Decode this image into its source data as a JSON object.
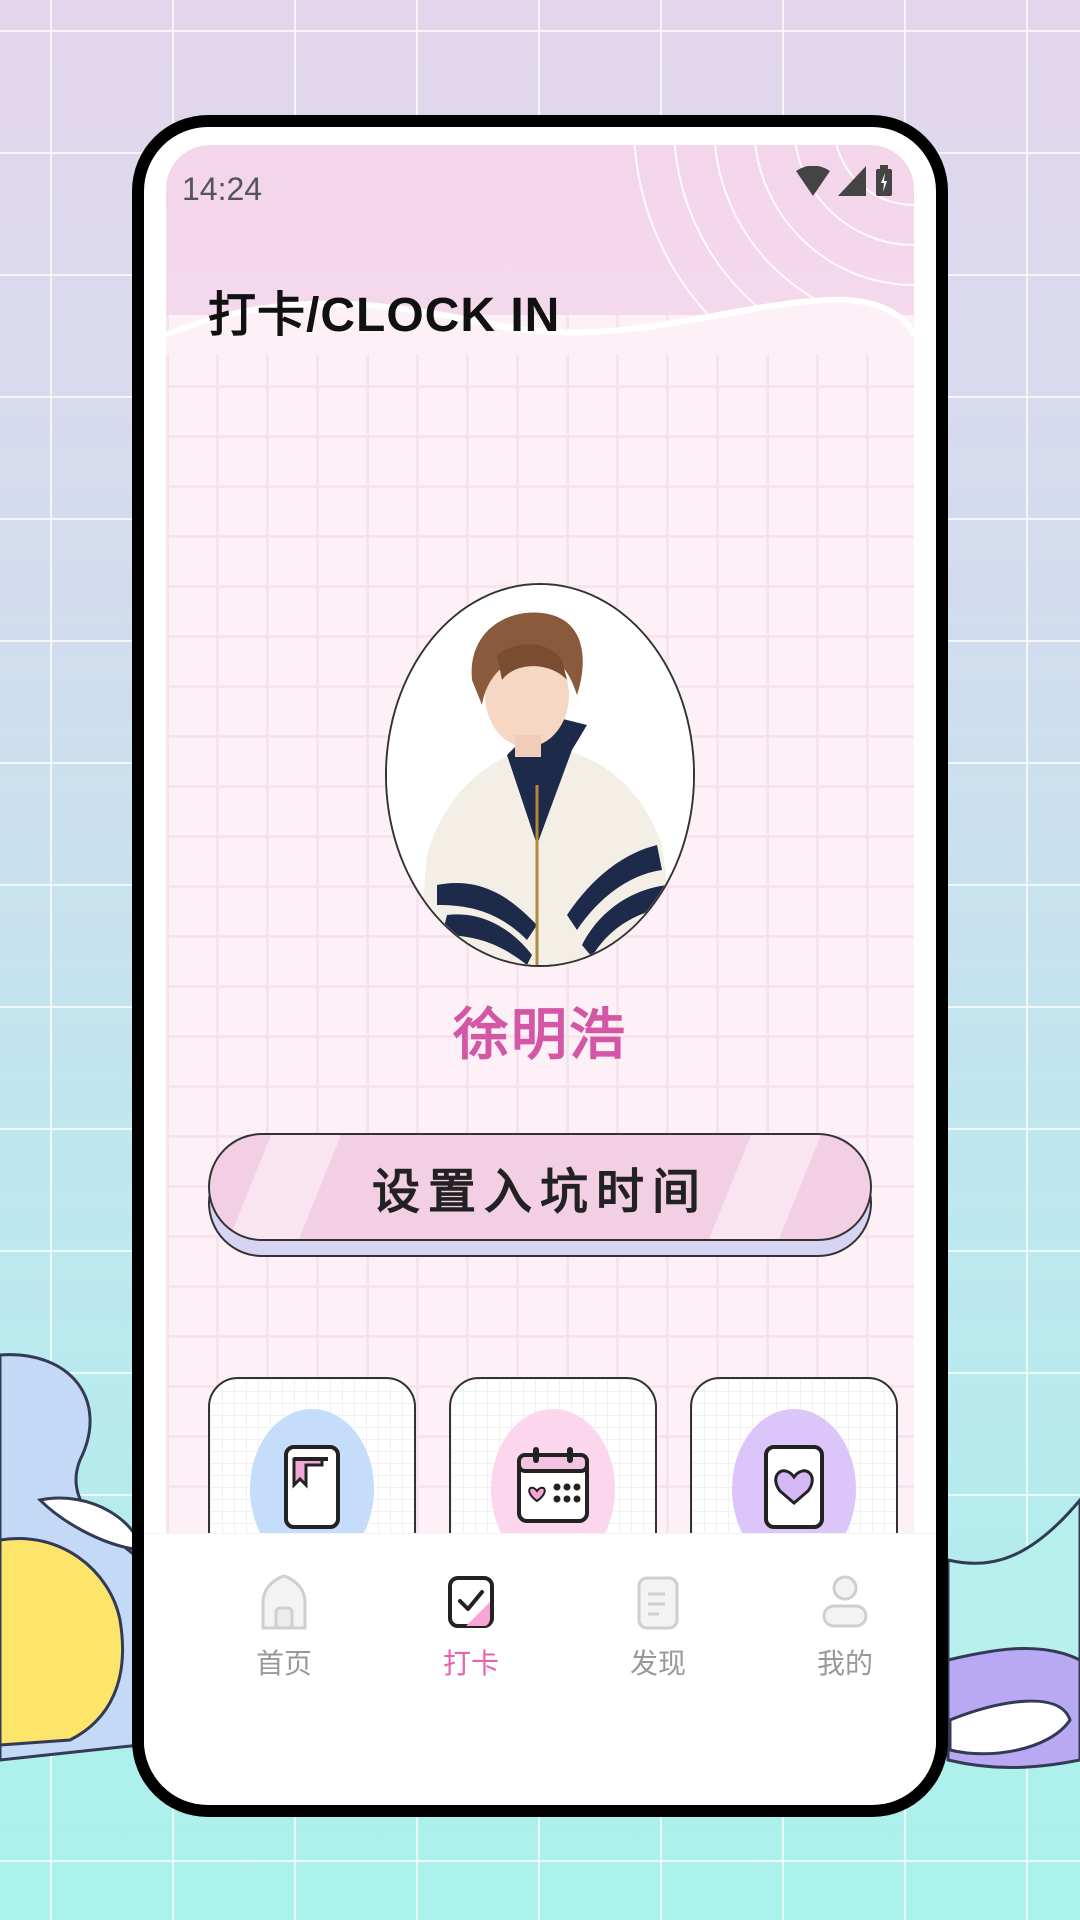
{
  "status_bar": {
    "time": "14:24"
  },
  "header": {
    "title": "打卡/CLOCK IN"
  },
  "idol": {
    "name": "徐明浩"
  },
  "cta": {
    "label": "设置入坑时间"
  },
  "features": [
    {
      "icon": "bookmark-phone-icon",
      "color": "#c5dcfb"
    },
    {
      "icon": "calendar-heart-icon",
      "color": "#fbd6ec"
    },
    {
      "icon": "heart-card-icon",
      "color": "#dcc6f9"
    }
  ],
  "tabs": [
    {
      "label": "首页",
      "icon": "home-icon"
    },
    {
      "label": "打卡",
      "icon": "checkin-icon",
      "active": true
    },
    {
      "label": "发现",
      "icon": "discover-icon"
    },
    {
      "label": "我的",
      "icon": "profile-icon"
    }
  ],
  "colors": {
    "accent": "#e463ae",
    "name": "#d457a6",
    "header": "#f3d6ea"
  }
}
